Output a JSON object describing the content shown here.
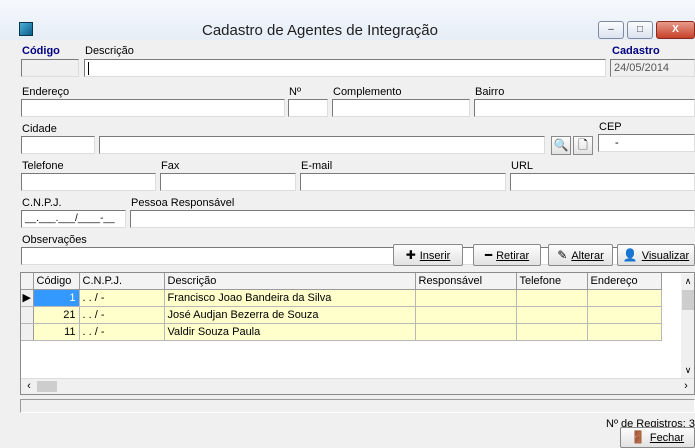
{
  "window": {
    "title": "Cadastro de Agentes de Integração",
    "min_glyph": "–",
    "max_glyph": "□",
    "close_glyph": "X"
  },
  "form": {
    "codigo_label": "Código",
    "descricao_label": "Descrição",
    "cadastro_label": "Cadastro",
    "cadastro_value": "24/05/2014",
    "endereco_label": "Endereço",
    "numero_label": "Nº",
    "complemento_label": "Complemento",
    "bairro_label": "Bairro",
    "cidade_label": "Cidade",
    "cep_label": "CEP",
    "cep_value": "-",
    "telefone_label": "Telefone",
    "fax_label": "Fax",
    "email_label": "E-mail",
    "url_label": "URL",
    "cnpj_label": "C.N.P.J.",
    "cnpj_mask": "__.___.___/____-__",
    "responsavel_label": "Pessoa Responsável",
    "observacoes_label": "Observações"
  },
  "actions": {
    "inserir": "Inserir",
    "retirar": "Retirar",
    "alterar": "Alterar",
    "visualizar": "Visualizar",
    "fechar": "Fechar"
  },
  "grid": {
    "columns": [
      "Código",
      "C.N.P.J.",
      "Descrição",
      "Responsável",
      "Telefone",
      "Endereço"
    ],
    "rows": [
      {
        "codigo": "1",
        "cnpj": ". . / -",
        "descricao": "Francisco Joao Bandeira da Silva",
        "responsavel": "",
        "telefone": "",
        "endereco": ""
      },
      {
        "codigo": "21",
        "cnpj": ". . / -",
        "descricao": "José Audjan Bezerra de Souza",
        "responsavel": "",
        "telefone": "",
        "endereco": ""
      },
      {
        "codigo": "11",
        "cnpj": ". . / -",
        "descricao": "Valdir Souza Paula",
        "responsavel": "",
        "telefone": "",
        "endereco": ""
      }
    ]
  },
  "status": {
    "registros": "Nº de Registros: 3"
  }
}
